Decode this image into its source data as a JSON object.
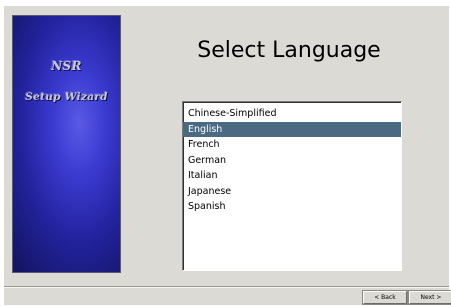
{
  "banner": {
    "product": "NSR",
    "subtitle": "Setup Wizard"
  },
  "page": {
    "title": "Select Language"
  },
  "languages": {
    "items": [
      "Chinese-Simplified",
      "English",
      "French",
      "German",
      "Italian",
      "Japanese",
      "Spanish"
    ],
    "selected": "English"
  },
  "buttons": {
    "back": "< Back",
    "next": "Next >"
  },
  "colors": {
    "window_background": "#dcdad5",
    "banner_blue": "#3a3ad0",
    "selection_background": "#4b6983"
  }
}
